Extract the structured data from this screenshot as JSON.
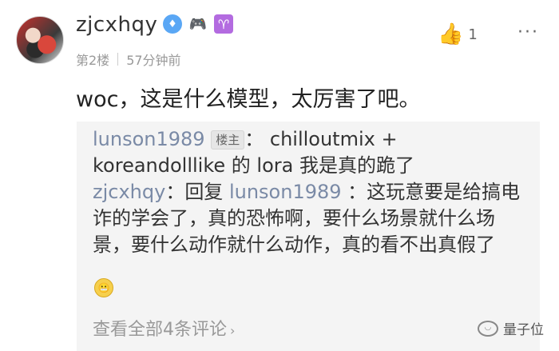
{
  "comment": {
    "username": "zjcxhqy",
    "floor": "第2楼",
    "time": "57分钟前",
    "like_count": "1",
    "text": "woc，这是什么模型，太厉害了吧。"
  },
  "badges": {
    "diamond_icon": "diamond-icon",
    "game_icon": "gamepad-icon",
    "zodiac_icon": "aries-icon"
  },
  "replies": [
    {
      "author": "lunson1989",
      "tag": "楼主",
      "colon": "：",
      "line1_text": "chilloutmix +",
      "line2_text": "koreandolllike 的 lora 我是真的跪了"
    },
    {
      "author": "zjcxhqy",
      "colon": "：",
      "reply_word": "回复",
      "reply_to": "lunson1989",
      "reply_colon": "：",
      "line1_text": "这玩意要是给搞电",
      "line2_text": "诈的学会了，真的恐怖啊，要什么场景就什么场",
      "line3_text": "景，要什么动作就什么动作，真的看不出真假了"
    }
  ],
  "view_all": "查看全部4条评论",
  "watermark": "量子位"
}
